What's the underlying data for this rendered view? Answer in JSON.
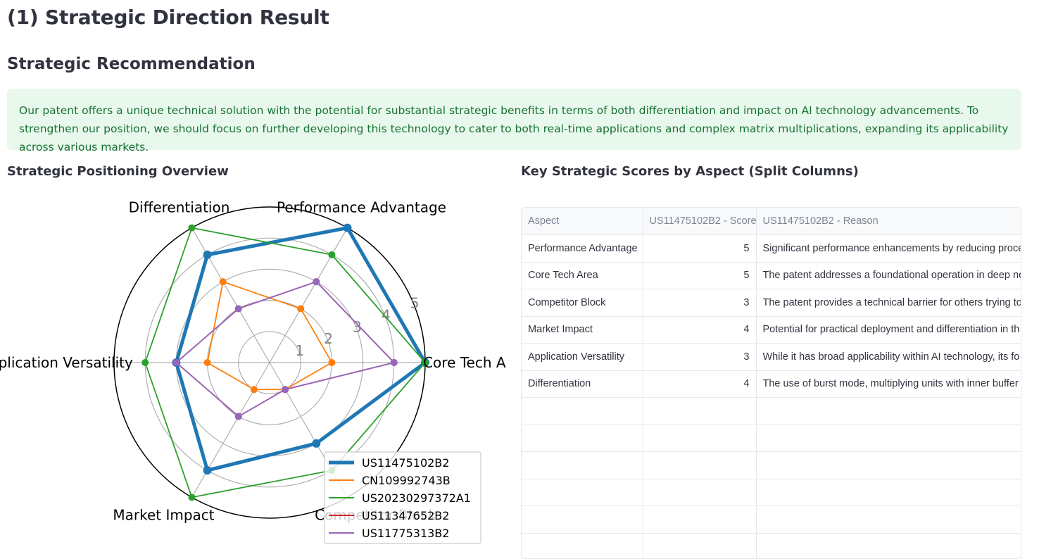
{
  "page": {
    "title": "(1) Strategic Direction Result",
    "recommendation_heading": "Strategic Recommendation",
    "recommendation_text": "Our patent offers a unique technical solution with the potential for substantial strategic benefits in terms of both differentiation and impact on AI technology advancements. To strengthen our position, we should focus on further developing this technology to cater to both real-time applications and complex matrix multiplications, expanding its applicability across various markets.",
    "radar_heading": "Strategic Positioning Overview",
    "table_heading": "Key Strategic Scores by Aspect (Split Columns)"
  },
  "chart_data": {
    "type": "radar",
    "axes": [
      "Core Tech Area",
      "Performance Advantage",
      "Differentiation",
      "Application Versatility",
      "Market Impact",
      "Competitor Block"
    ],
    "radial_ticks": [
      "1",
      "2",
      "3",
      "4",
      "5"
    ],
    "rlim": [
      0,
      5
    ],
    "legend_position": "bottom-right",
    "series": [
      {
        "name": "US11475102B2",
        "color": "#1f77b4",
        "values": [
          5,
          5,
          4,
          3,
          4,
          3
        ]
      },
      {
        "name": "CN109992743B",
        "color": "#ff7f0e",
        "values": [
          2,
          2,
          3,
          2,
          1,
          1
        ]
      },
      {
        "name": "US20230297372A1",
        "color": "#2ca02c",
        "values": [
          5,
          4,
          5,
          4,
          5,
          4
        ]
      },
      {
        "name": "US11347652B2",
        "color": "#d62728",
        "values": [
          4,
          3,
          2,
          3,
          2,
          1
        ]
      },
      {
        "name": "US11775313B2",
        "color": "#9467bd",
        "values": [
          4,
          3,
          2,
          3,
          2,
          1
        ]
      }
    ]
  },
  "table": {
    "headers": [
      "Aspect",
      "US11475102B2 - Score",
      "US11475102B2 - Reason"
    ],
    "rows": [
      [
        "Performance Advantage",
        "5",
        "Significant performance enhancements by reducing proce"
      ],
      [
        "Core Tech Area",
        "5",
        "The patent addresses a foundational operation in deep ne"
      ],
      [
        "Competitor Block",
        "3",
        "The patent provides a technical barrier for others trying to"
      ],
      [
        "Market Impact",
        "4",
        "Potential for practical deployment and differentiation in th"
      ],
      [
        "Application Versatility",
        "3",
        "While it has broad applicability within AI technology, its fo"
      ],
      [
        "Differentiation",
        "4",
        "The use of burst mode, multiplying units with inner buffer"
      ]
    ]
  }
}
